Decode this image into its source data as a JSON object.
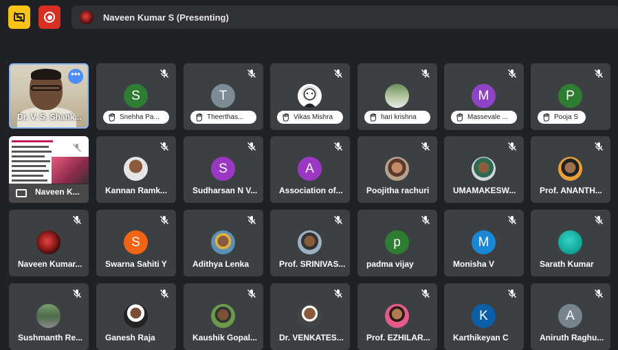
{
  "topbar": {
    "presenting_text": "Naveen Kumar S (Presenting)"
  },
  "colors": {
    "background": "#202124",
    "tile": "#3c4043",
    "captions_button": "#f9c417",
    "record_button": "#d93025",
    "selfview_border": "#8ab4f8"
  },
  "tiles": {
    "self": {
      "name": "Dr. V. S. Shank...",
      "more": "•••"
    },
    "screen": {
      "name": "Naveen K..."
    },
    "r1c2": {
      "name": "Snehha Pa...",
      "letter": "S",
      "color": "#2e7d32"
    },
    "r1c3": {
      "name": "Theerthas...",
      "letter": "T",
      "color": "#7b8c94"
    },
    "r1c4": {
      "name": "Vikas Mishra"
    },
    "r1c5": {
      "name": "hari krishna"
    },
    "r1c6": {
      "name": "Massevale ...",
      "letter": "M",
      "color": "#8e44c4"
    },
    "r1c7": {
      "name": "Pooja S",
      "letter": "P",
      "color": "#2e7d32"
    },
    "r2c2": {
      "name": "Kannan Ramk..."
    },
    "r2c3": {
      "name": "Sudharsan N V...",
      "letter": "S",
      "color": "#9c37c4"
    },
    "r2c4": {
      "name": "Association of...",
      "letter": "A",
      "color": "#9c37c4"
    },
    "r2c5": {
      "name": "Poojitha rachuri"
    },
    "r2c6": {
      "name": "UMAMAKESW..."
    },
    "r2c7": {
      "name": "Prof. ANANTH..."
    },
    "r3c1": {
      "name": "Naveen Kumar..."
    },
    "r3c2": {
      "name": "Swarna Sahiti Y",
      "letter": "S",
      "color": "#f06414"
    },
    "r3c3": {
      "name": "Adithya Lenka"
    },
    "r3c4": {
      "name": "Prof. SRINIVAS..."
    },
    "r3c5": {
      "name": "padma vijay",
      "letter": "p",
      "color": "#2e7d32"
    },
    "r3c6": {
      "name": "Monisha V",
      "letter": "M",
      "color": "#1a88d4"
    },
    "r3c7": {
      "name": "Sarath Kumar"
    },
    "r4c1": {
      "name": "Sushmanth Re..."
    },
    "r4c2": {
      "name": "Ganesh Raja"
    },
    "r4c3": {
      "name": "Kaushik Gopal..."
    },
    "r4c4": {
      "name": "Dr. VENKATES..."
    },
    "r4c5": {
      "name": "Prof. EZHILAR..."
    },
    "r4c6": {
      "name": "Karthikeyan C",
      "letter": "K",
      "color": "#0b5ea8"
    },
    "r4c7": {
      "name": "Aniruth Raghu...",
      "letter": "A",
      "color": "#78848c"
    }
  }
}
